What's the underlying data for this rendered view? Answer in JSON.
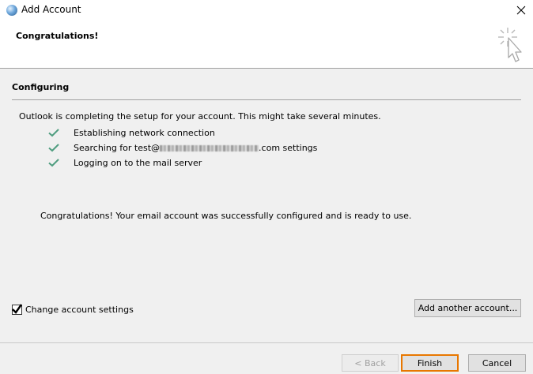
{
  "window": {
    "title": "Add Account"
  },
  "header": {
    "title": "Congratulations!"
  },
  "section": {
    "title": "Configuring",
    "intro": "Outlook is completing the setup for your account. This might take several minutes.",
    "steps": [
      {
        "label": "Establishing network connection",
        "status": "done"
      },
      {
        "label_prefix": "Searching for test@",
        "label_suffix": ".com settings",
        "status": "done"
      },
      {
        "label": "Logging on to the mail server",
        "status": "done"
      }
    ],
    "success_message": "Congratulations! Your email account was successfully configured and is ready to use."
  },
  "options": {
    "change_settings_label": "Change account settings",
    "change_settings_checked": true,
    "add_another_label": "Add another account..."
  },
  "footer": {
    "back_label": "< Back",
    "finish_label": "Finish",
    "cancel_label": "Cancel"
  },
  "colors": {
    "check": "#4f9d7f",
    "finish_focus": "#e87700"
  }
}
